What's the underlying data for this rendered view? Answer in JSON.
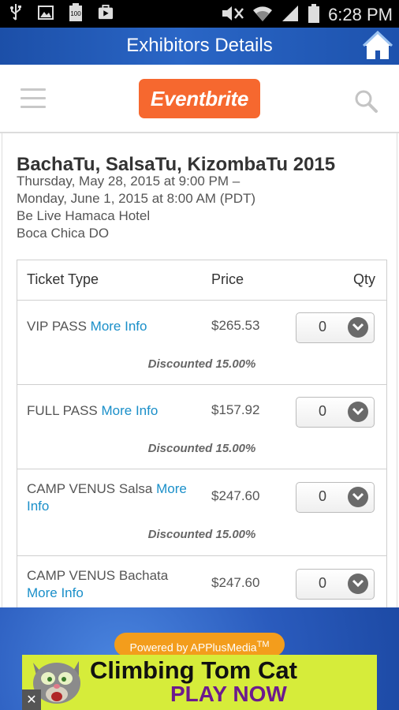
{
  "status_bar": {
    "time": "6:28 PM",
    "battery_label": "100"
  },
  "app_bar": {
    "title": "Exhibitors Details"
  },
  "nav": {
    "logo_text": "Eventbrite"
  },
  "event": {
    "title": "BachaTu, SalsaTu, KizombaTu 2015",
    "date_start": "Thursday, May 28, 2015 at 9:00 PM –",
    "date_end": "Monday, June 1, 2015 at 8:00 AM (PDT)",
    "venue": "Be Live Hamaca Hotel",
    "city": "Boca Chica DO"
  },
  "tickets": {
    "headers": {
      "type": "Ticket Type",
      "price": "Price",
      "qty": "Qty"
    },
    "rows": [
      {
        "name": "VIP PASS",
        "more": "More Info",
        "price": "$265.53",
        "qty": "0",
        "discount": "Discounted 15.00%"
      },
      {
        "name": "FULL PASS",
        "more": "More Info",
        "price": "$157.92",
        "qty": "0",
        "discount": "Discounted 15.00%"
      },
      {
        "name": "CAMP VENUS Salsa",
        "more": "More Info",
        "price": "$247.60",
        "qty": "0",
        "discount": "Discounted 15.00%"
      },
      {
        "name": "CAMP VENUS Bachata",
        "more": "More Info",
        "price": "$247.60",
        "qty": "0",
        "discount": ""
      }
    ]
  },
  "ad": {
    "powered_by": "Powered by APPlusMedia",
    "powered_by_tm": "TM",
    "banner_title": "Climbing Tom Cat",
    "banner_cta": "PLAY NOW",
    "close_label": "✕"
  },
  "colors": {
    "app_bar": "#2a66c6",
    "logo": "#f6682f",
    "link": "#1a8fc9",
    "powered": "#f39d1c",
    "banner": "#d6ec3a"
  }
}
